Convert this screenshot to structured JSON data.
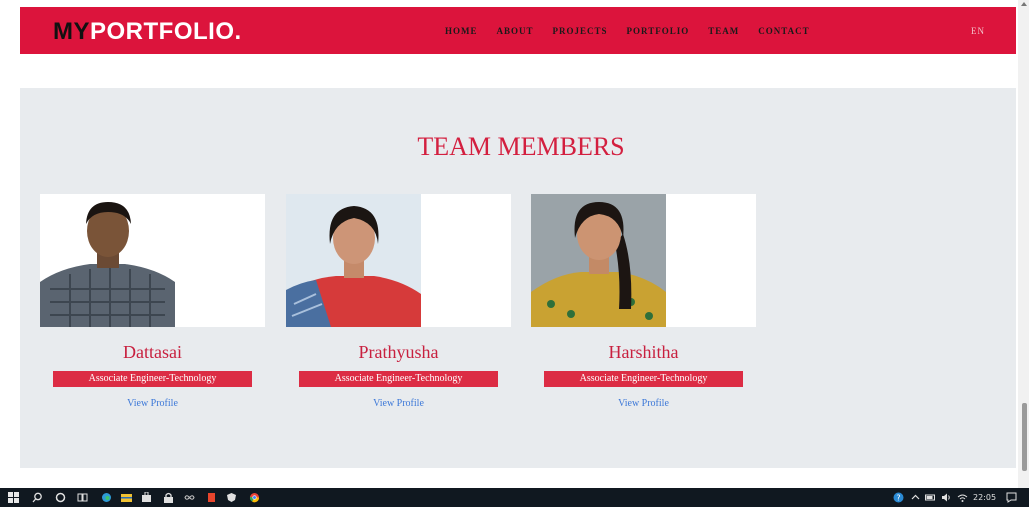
{
  "header": {
    "logo_my": "MY",
    "logo_rest": "PORTFOLIO.",
    "nav": [
      "HOME",
      "ABOUT",
      "PROJECTS",
      "PORTFOLIO",
      "TEAM",
      "CONTACT"
    ],
    "language": "EN"
  },
  "team": {
    "title": "TEAM MEMBERS",
    "members": [
      {
        "name": "Dattasai",
        "role": "Associate Engineer-Technology",
        "link": "View Profile"
      },
      {
        "name": "Prathyusha",
        "role": "Associate Engineer-Technology",
        "link": "View Profile"
      },
      {
        "name": "Harshitha",
        "role": "Associate Engineer-Technology",
        "link": "View Profile"
      }
    ]
  },
  "taskbar": {
    "time": "22:05",
    "icons": [
      "windows-start-icon",
      "search-icon",
      "cortana-icon",
      "task-view-icon",
      "edge-icon",
      "file-explorer-icon",
      "store-icon",
      "lock-icon",
      "infinity-icon",
      "office-icon",
      "shield-icon",
      "chrome-icon"
    ],
    "tray_icons": [
      "help-icon",
      "chevron-up-icon",
      "battery-icon",
      "volume-icon",
      "wifi-icon",
      "notification-icon"
    ]
  },
  "colors": {
    "brand": "#dc143c",
    "section_bg": "#e8ebee",
    "link": "#3c78d8"
  }
}
